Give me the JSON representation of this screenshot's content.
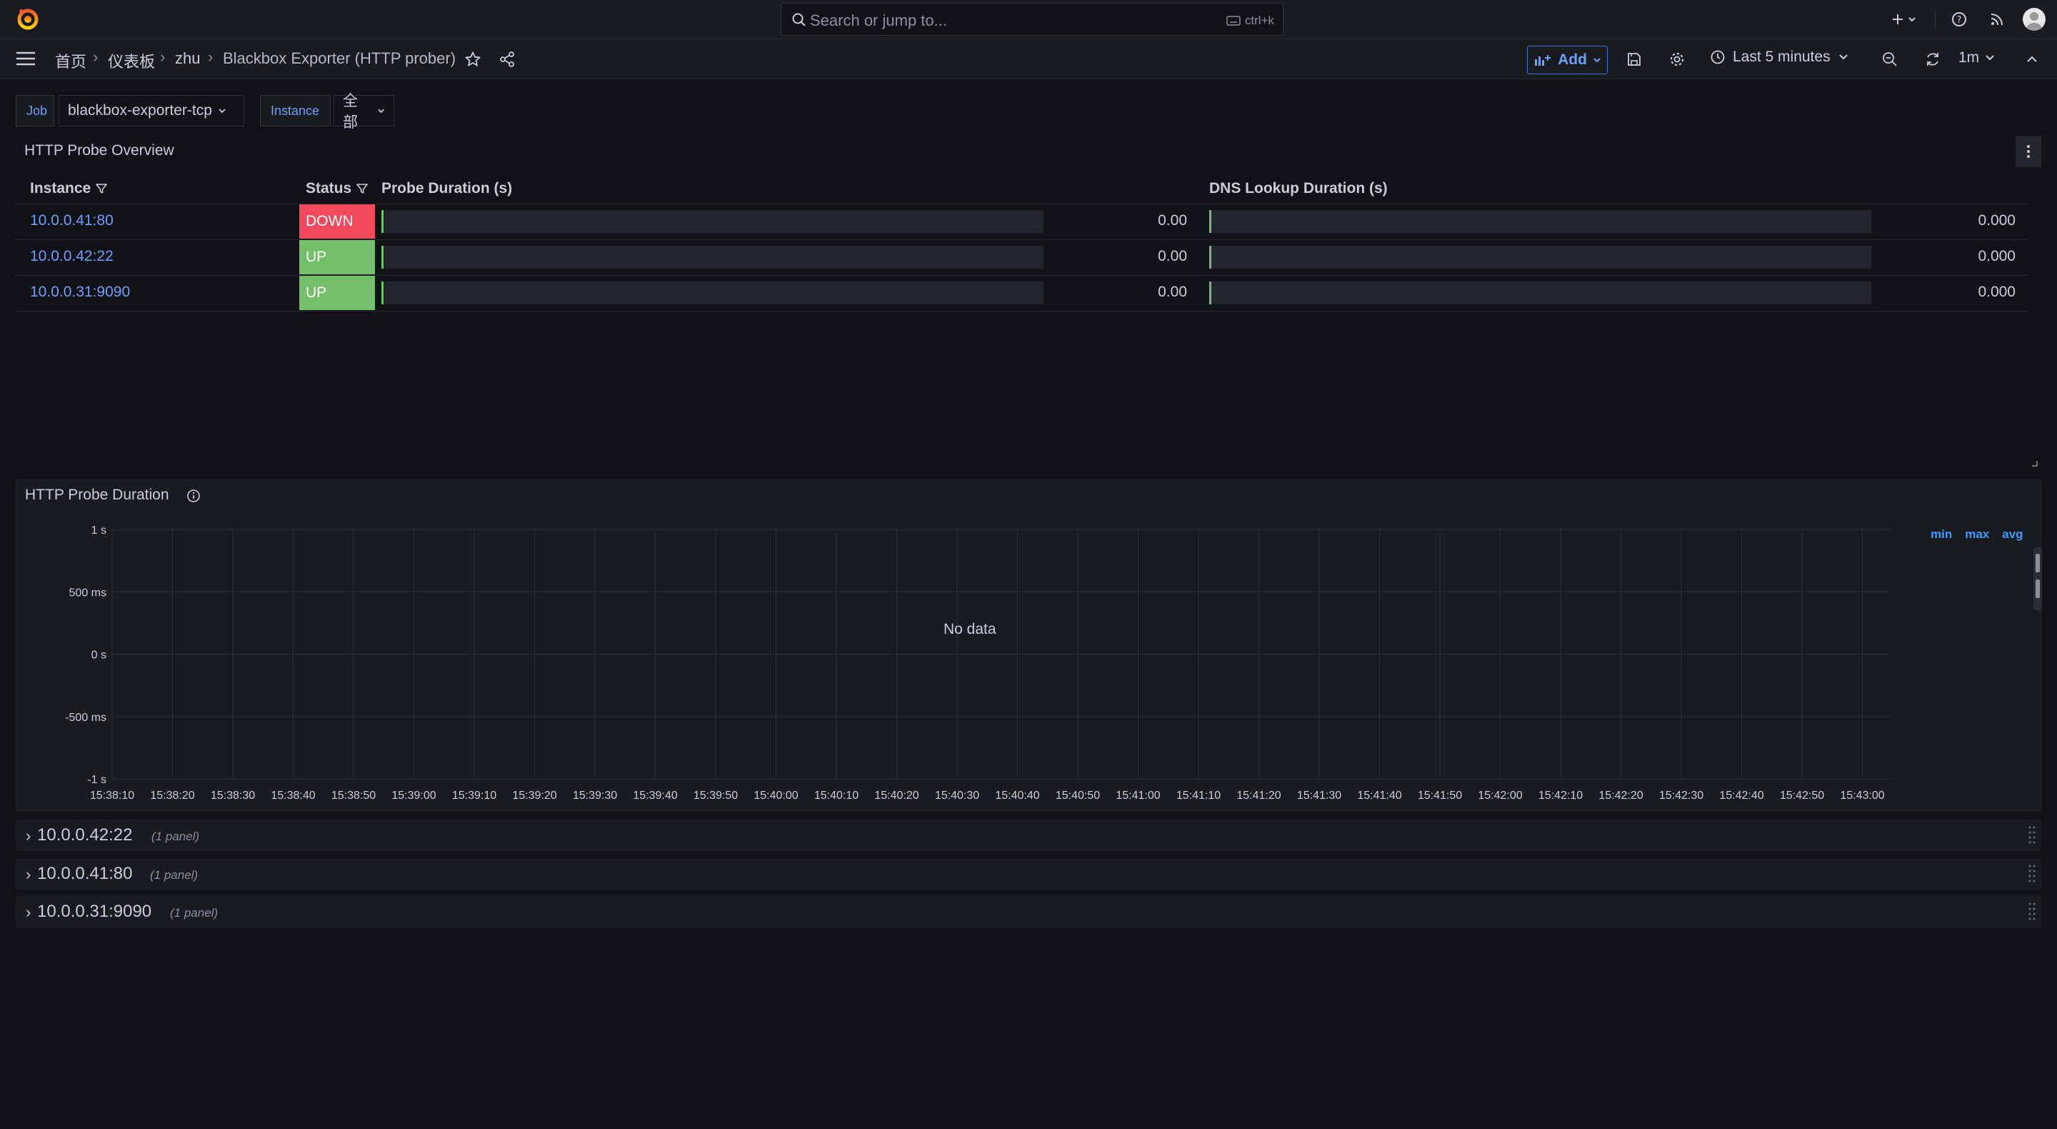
{
  "topbar": {
    "search_placeholder": "Search or jump to...",
    "search_shortcut": "ctrl+k",
    "icons": [
      "grafana-logo-icon",
      "plus-icon",
      "help-icon",
      "news-icon",
      "user-avatar"
    ]
  },
  "nav": {
    "breadcrumbs": [
      "首页",
      "仪表板",
      "zhu",
      "Blackbox Exporter (HTTP prober)"
    ],
    "add_label": "Add",
    "time_range": "Last 5 minutes",
    "refresh_interval": "1m"
  },
  "variables": {
    "job_label": "Job",
    "job_value": "blackbox-exporter-tcp",
    "instance_label": "Instance",
    "instance_value": "全部"
  },
  "overview": {
    "title": "HTTP Probe Overview",
    "columns": [
      "Instance",
      "Status",
      "Probe Duration (s)",
      "DNS Lookup Duration (s)"
    ],
    "rows": [
      {
        "instance": "10.0.0.41:80",
        "status": "DOWN",
        "probe": "0.00",
        "probe_fraction": 0,
        "dns": "0.000",
        "dns_fraction": 0
      },
      {
        "instance": "10.0.0.42:22",
        "status": "UP",
        "probe": "0.00",
        "probe_fraction": 0,
        "dns": "0.000",
        "dns_fraction": 0
      },
      {
        "instance": "10.0.0.31:9090",
        "status": "UP",
        "probe": "0.00",
        "probe_fraction": 0,
        "dns": "0.000",
        "dns_fraction": 0
      }
    ],
    "colors": {
      "down": "#f2495c",
      "up": "#73bf69",
      "link": "#6e9fff"
    }
  },
  "duration_panel": {
    "title": "HTTP Probe Duration",
    "no_data": "No data",
    "legend_headers": [
      "min",
      "max",
      "avg"
    ]
  },
  "chart_data": {
    "type": "line",
    "title": "HTTP Probe Duration",
    "y_ticks": [
      "1 s",
      "500 ms",
      "0 s",
      "-500 ms",
      "-1 s"
    ],
    "x_ticks": [
      "15:38:10",
      "15:38:20",
      "15:38:30",
      "15:38:40",
      "15:38:50",
      "15:39:00",
      "15:39:10",
      "15:39:20",
      "15:39:30",
      "15:39:40",
      "15:39:50",
      "15:40:00",
      "15:40:10",
      "15:40:20",
      "15:40:30",
      "15:40:40",
      "15:40:50",
      "15:41:00",
      "15:41:10",
      "15:41:20",
      "15:41:30",
      "15:41:40",
      "15:41:50",
      "15:42:00",
      "15:42:10",
      "15:42:20",
      "15:42:30",
      "15:42:40",
      "15:42:50",
      "15:43:00"
    ],
    "ylim": [
      -1,
      1
    ],
    "series": [],
    "grid": true
  },
  "row_sections": [
    {
      "title": "10.0.0.42:22",
      "count": "(1 panel)"
    },
    {
      "title": "10.0.0.41:80",
      "count": "(1 panel)"
    },
    {
      "title": "10.0.0.31:9090",
      "count": "(1 panel)"
    }
  ]
}
